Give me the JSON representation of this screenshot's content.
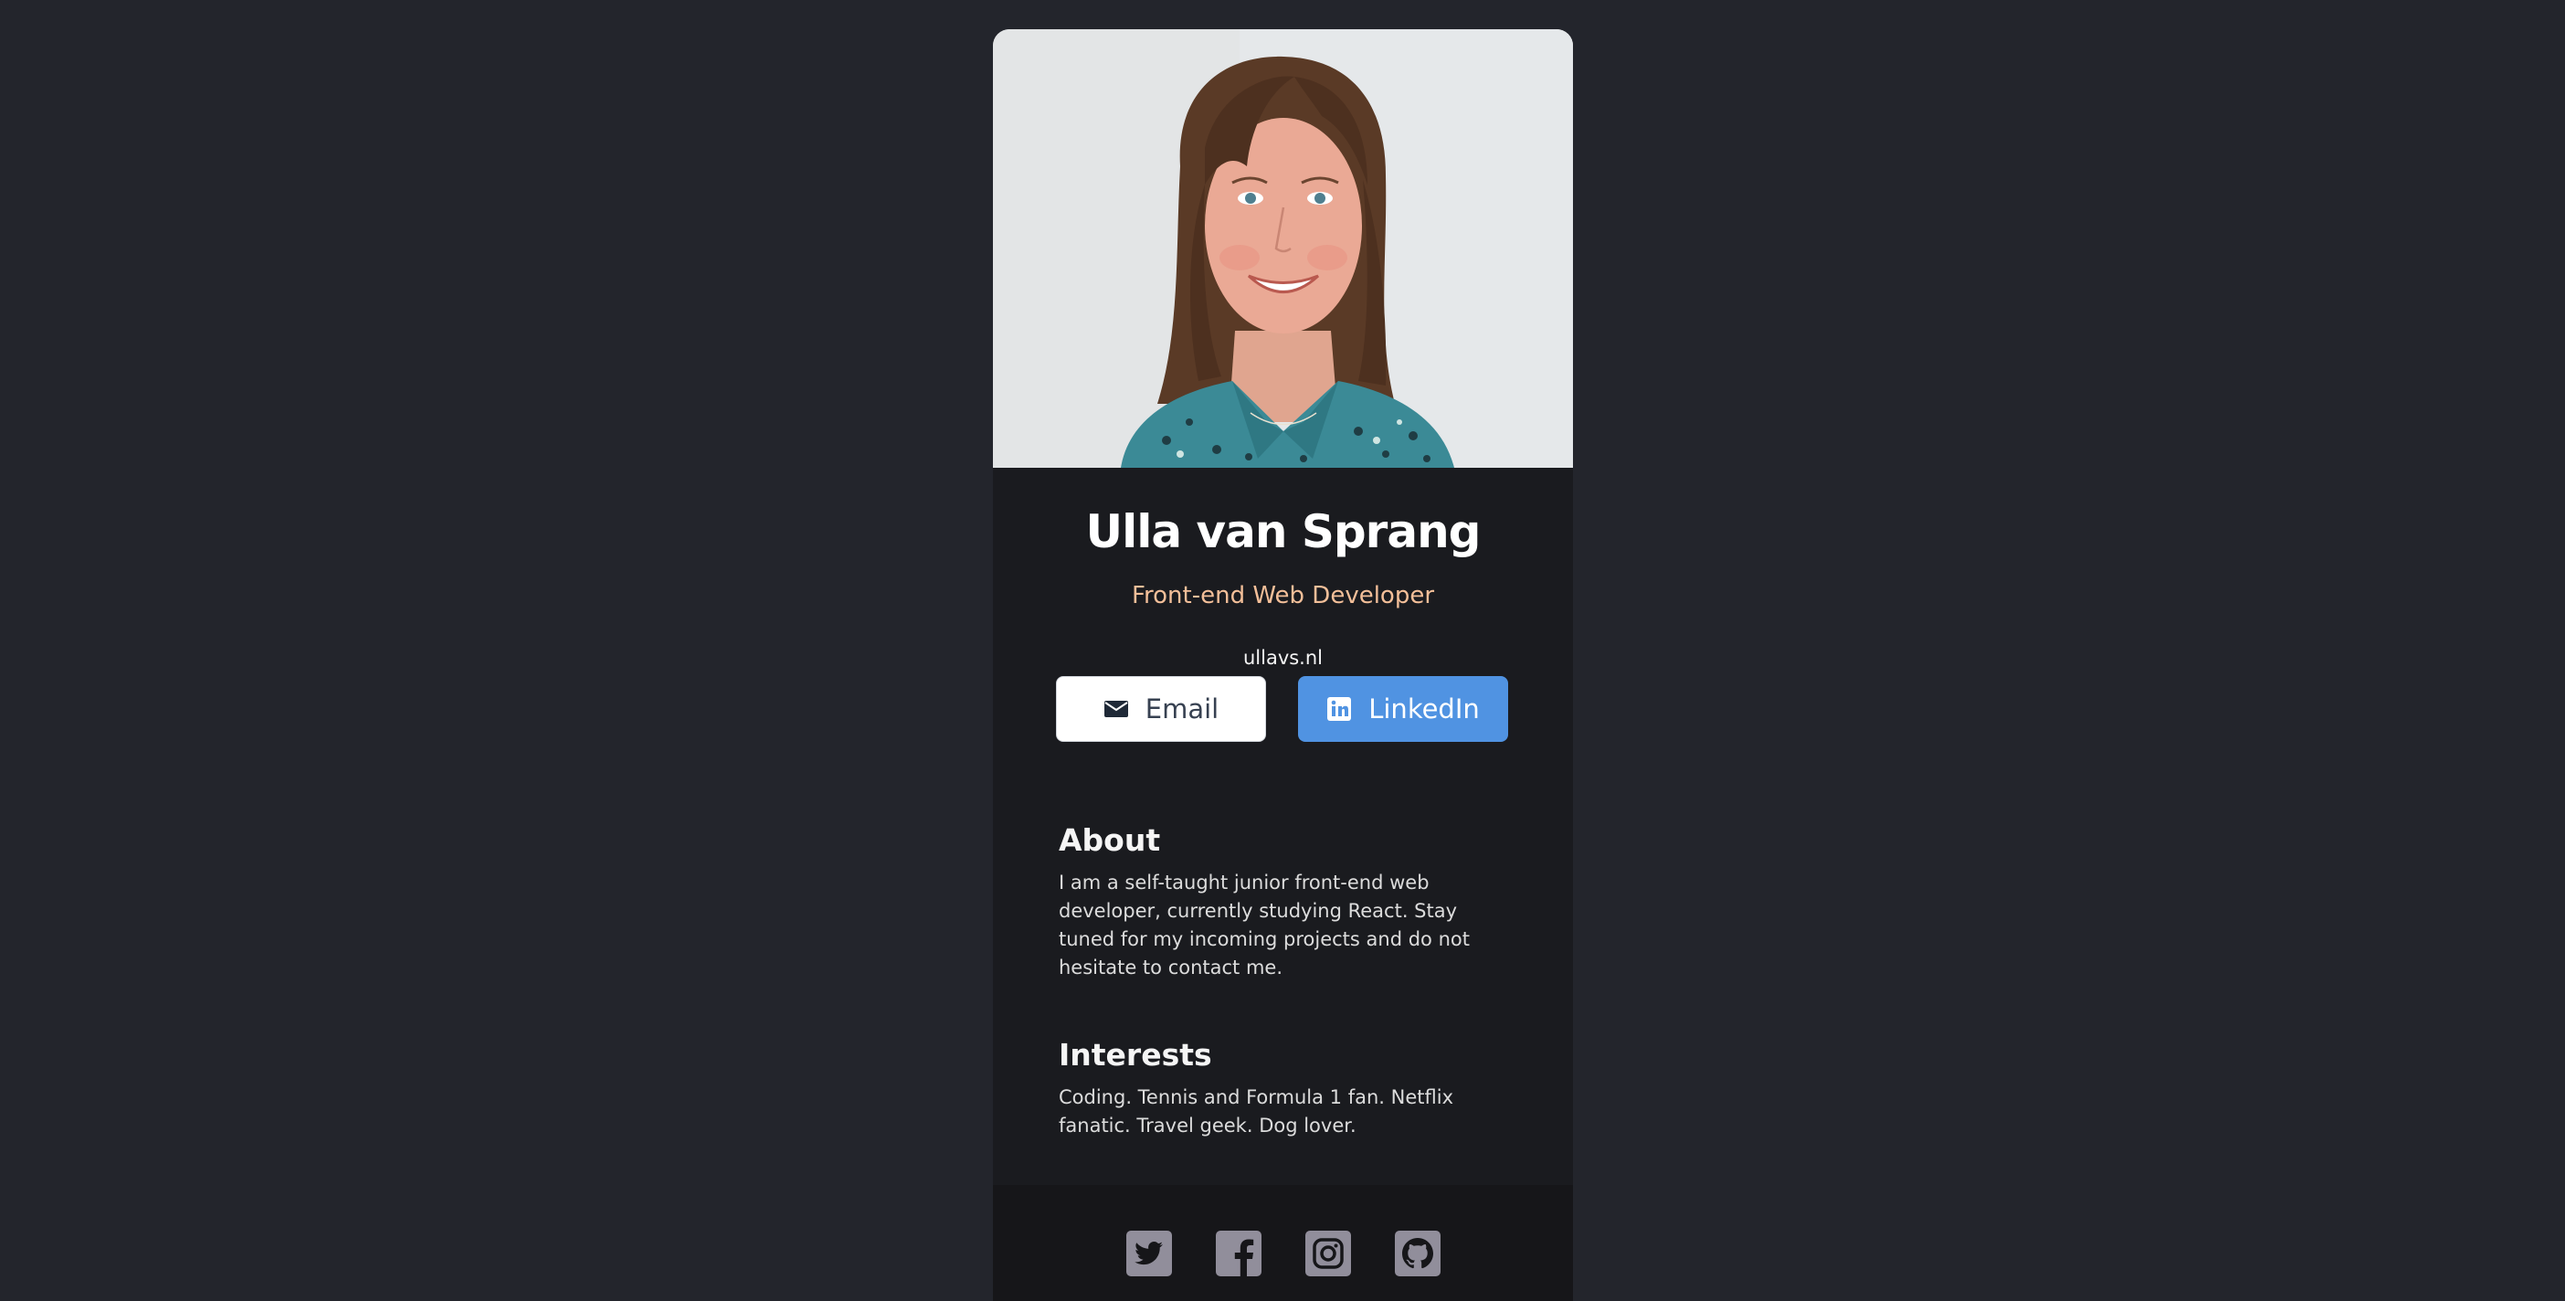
{
  "profile": {
    "name": "Ulla van Sprang",
    "title": "Front-end Web Developer",
    "website": "ullavs.nl",
    "photo_alt": "portrait-photo"
  },
  "buttons": {
    "email_label": "Email",
    "linkedin_label": "LinkedIn",
    "email_icon": "mail-icon",
    "linkedin_icon": "linkedin-icon"
  },
  "about": {
    "heading": "About",
    "text": "I am a self-taught junior front-end web developer, currently studying React. Stay tuned for my incoming projects and do not hesitate to contact me."
  },
  "interests": {
    "heading": "Interests",
    "text": "Coding. Tennis and Formula 1 fan. Netflix fanatic. Travel geek. Dog lover."
  },
  "footer": {
    "icons": [
      "twitter-icon",
      "facebook-icon",
      "instagram-icon",
      "github-icon"
    ]
  },
  "colors": {
    "background": "#23252c",
    "card": "#1a1b1f",
    "footer": "#161619",
    "accent_title": "#f3bf99",
    "linkedin_button": "#5093e2",
    "social_icon": "#918e9b"
  }
}
